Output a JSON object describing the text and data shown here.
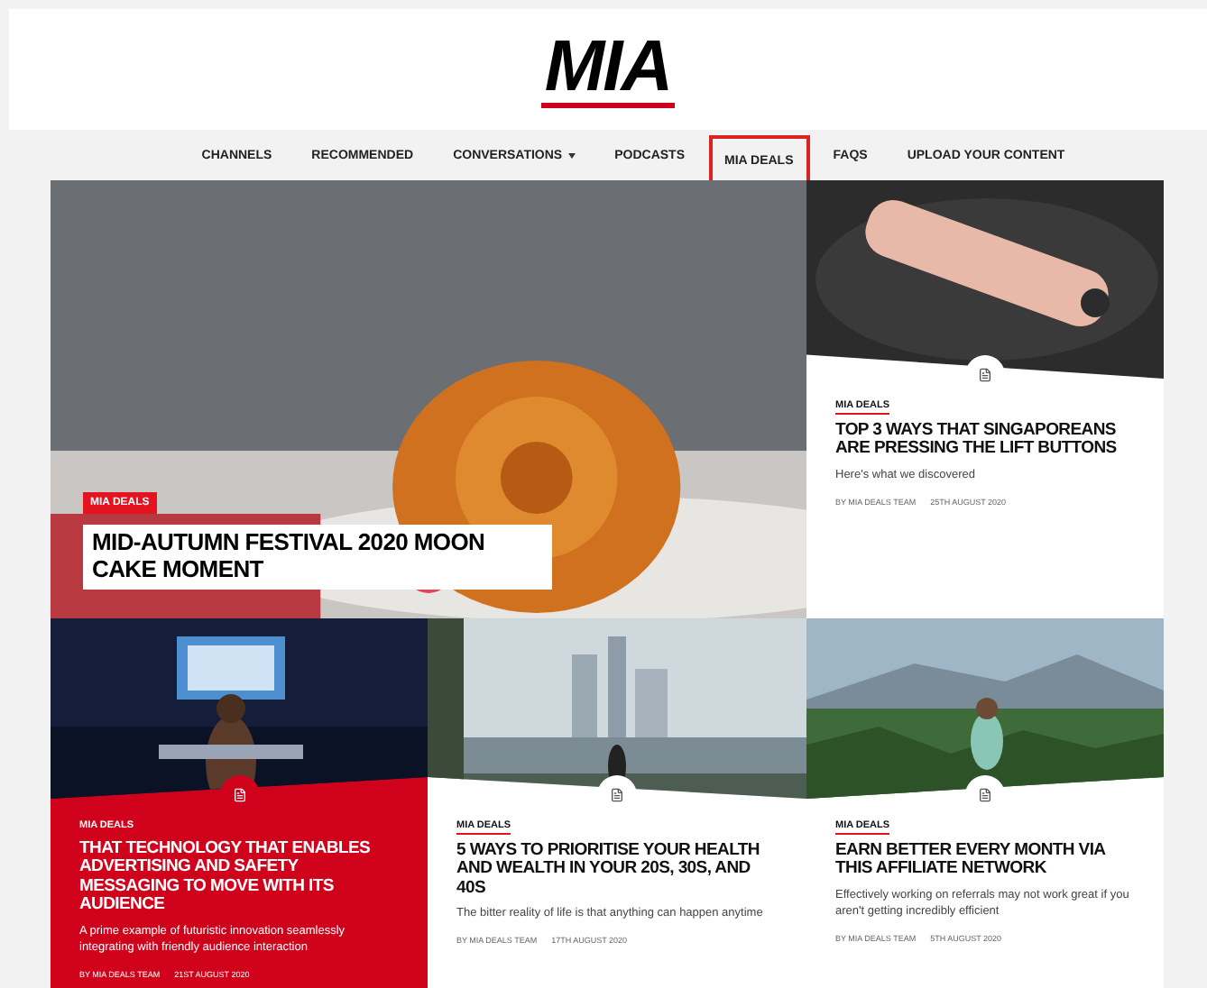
{
  "logo": "MIA",
  "nav": [
    {
      "label": "CHANNELS",
      "selected": false,
      "dropdown": false
    },
    {
      "label": "RECOMMENDED",
      "selected": false,
      "dropdown": false
    },
    {
      "label": "CONVERSATIONS",
      "selected": false,
      "dropdown": true
    },
    {
      "label": "PODCASTS",
      "selected": false,
      "dropdown": false
    },
    {
      "label": "MIA DEALS",
      "selected": true,
      "dropdown": false
    },
    {
      "label": "FAQS",
      "selected": false,
      "dropdown": false
    },
    {
      "label": "UPLOAD YOUR CONTENT",
      "selected": false,
      "dropdown": false
    }
  ],
  "articles": [
    {
      "kind": "hero",
      "category": "MIA DEALS",
      "title": "MID-AUTUMN FESTIVAL 2020 MOON CAKE MOMENT"
    },
    {
      "kind": "card",
      "category": "MIA DEALS",
      "title": "TOP 3 WAYS THAT SINGAPOREANS ARE PRESSING THE LIFT BUTTONS",
      "excerpt": "Here's what we discovered",
      "author": "BY MIA DEALS TEAM",
      "date": "25TH AUGUST 2020"
    },
    {
      "kind": "red",
      "category": "MIA DEALS",
      "title": "THAT TECHNOLOGY THAT ENABLES ADVERTISING AND SAFETY MESSAGING TO MOVE WITH ITS AUDIENCE",
      "excerpt": "A prime example of futuristic innovation seamlessly integrating with friendly audience interaction",
      "author": "BY MIA DEALS TEAM",
      "date": "21ST AUGUST 2020"
    },
    {
      "kind": "card",
      "category": "MIA DEALS",
      "title": "5 WAYS TO PRIORITISE YOUR HEALTH AND WEALTH IN YOUR 20S, 30S, AND 40S",
      "excerpt": "The bitter reality of life is that anything can happen anytime",
      "author": "BY MIA DEALS TEAM",
      "date": "17TH AUGUST 2020"
    },
    {
      "kind": "card",
      "category": "MIA DEALS",
      "title": "EARN BETTER EVERY MONTH VIA THIS AFFILIATE NETWORK",
      "excerpt": "Effectively working on referrals may not work great if you aren't getting incredibly efficient",
      "author": "BY MIA DEALS TEAM",
      "date": "5TH AUGUST 2020"
    }
  ]
}
